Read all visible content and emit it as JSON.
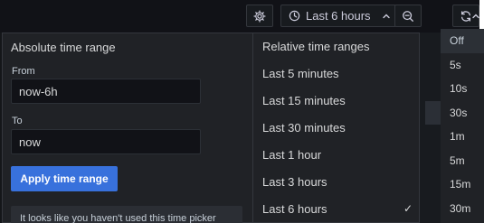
{
  "toolbar": {
    "time_range_label": "Last 6 hours"
  },
  "picker": {
    "absolute_title": "Absolute time range",
    "from_label": "From",
    "from_value": "now-6h",
    "to_label": "To",
    "to_value": "now",
    "apply_label": "Apply time range",
    "hint_text": "It looks like you haven't used this time picker"
  },
  "relative": {
    "title": "Relative time ranges",
    "items": [
      {
        "label": "Last 5 minutes"
      },
      {
        "label": "Last 15 minutes"
      },
      {
        "label": "Last 30 minutes"
      },
      {
        "label": "Last 1 hour"
      },
      {
        "label": "Last 3 hours"
      },
      {
        "label": "Last 6 hours",
        "selected": true
      }
    ],
    "check_glyph": "✓"
  },
  "refresh_menu": {
    "items": [
      "Off",
      "5s",
      "10s",
      "30s",
      "1m",
      "5m",
      "15m",
      "30m"
    ],
    "selected": "Off"
  }
}
